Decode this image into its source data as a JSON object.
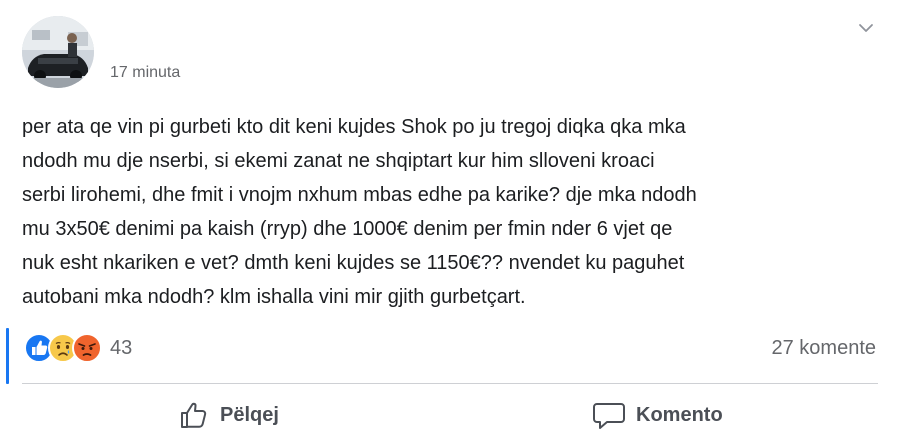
{
  "post": {
    "author_name": "",
    "time": "17 minuta",
    "text": "per ata qe vin pi gurbeti kto dit keni kujdes Shok po ju tregoj diqka qka mka\nndodh mu dje nserbi, si ekemi zanat ne shqiptart kur him slloveni kroaci\nserbi lirohemi, dhe fmit i vnojm nxhum mbas edhe pa karike? dje mka ndodh\nmu 3x50€ denimi pa kaish (rryp) dhe 1000€ denim per fmin nder 6 vjet qe\nnuk esht nkariken e vet? dmth keni kujdes se 1150€?? nvendet ku paguhet\nautobani mka ndodh? klm ishalla vini mir gjith gurbetçart."
  },
  "reactions": {
    "count": "43",
    "icons": [
      "like-icon",
      "sad-icon",
      "angry-icon"
    ],
    "comments_label": "27 komente"
  },
  "actions": {
    "like_label": "Pëlqej",
    "comment_label": "Komento"
  },
  "colors": {
    "accent": "#1877f2",
    "secondary_text": "#65676b",
    "action_text": "#4b4f56",
    "divider": "#ced0d4"
  }
}
